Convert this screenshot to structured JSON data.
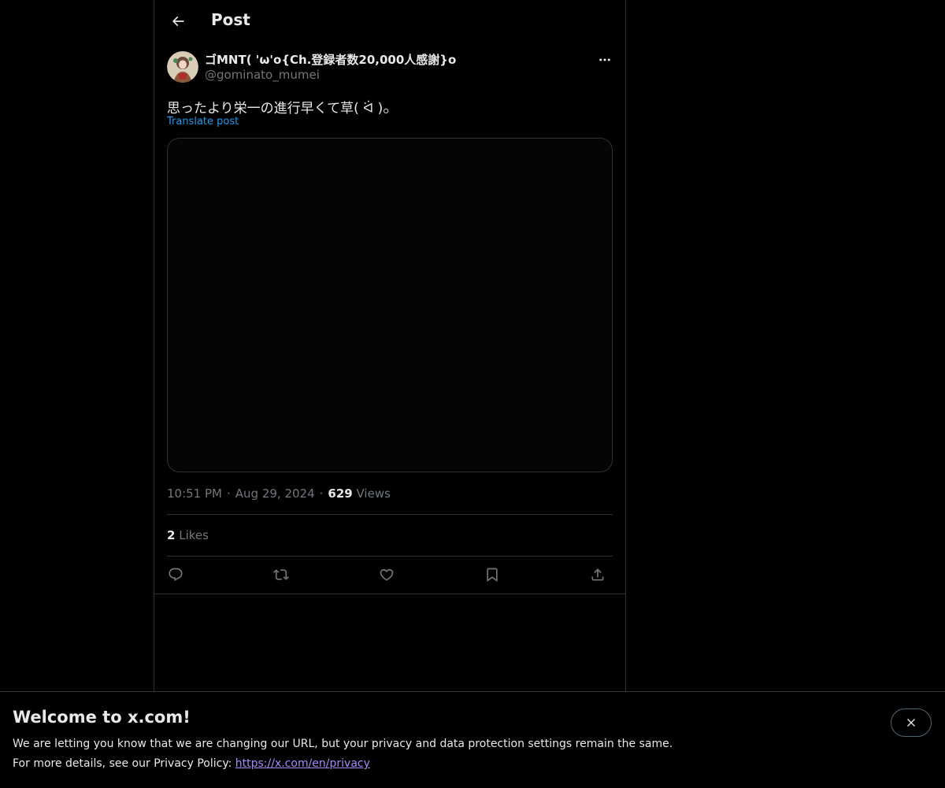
{
  "header": {
    "title": "Post",
    "back_icon": "arrow-left-icon"
  },
  "post": {
    "author": {
      "display_name": "ゴMNT( 'ω'o{Ch.登録者数20,000人感謝}o",
      "handle": "@gominato_mumei",
      "avatar_icon": "avatar-image"
    },
    "more_icon": "ellipsis-icon",
    "text": "思ったより栄一の進行早くて草( ᐛ )𓃉",
    "translate_label": "Translate post",
    "time": "10:51 PM",
    "separator": "·",
    "date": "Aug 29, 2024",
    "views_count": "629",
    "views_label": "Views",
    "likes_count": "2",
    "likes_label": "Likes",
    "actions": [
      {
        "name": "reply",
        "icon": "reply-icon"
      },
      {
        "name": "repost",
        "icon": "repost-icon"
      },
      {
        "name": "like",
        "icon": "heart-icon"
      },
      {
        "name": "bookmark",
        "icon": "bookmark-icon"
      },
      {
        "name": "share",
        "icon": "share-icon"
      }
    ]
  },
  "banner": {
    "title": "Welcome to x.com!",
    "line1": "We are letting you know that we are changing our URL, but your privacy and data protection settings remain the same.",
    "line2_prefix": "For more details, see our Privacy Policy:",
    "link_text": "https://x.com/en/privacy",
    "close_icon": "close-icon"
  },
  "colors": {
    "background": "#000000",
    "text_primary": "#e7e9ea",
    "text_secondary": "#71767b",
    "accent": "#1d9bf0",
    "border": "#2f3336",
    "link_visited": "#a78bfa"
  }
}
